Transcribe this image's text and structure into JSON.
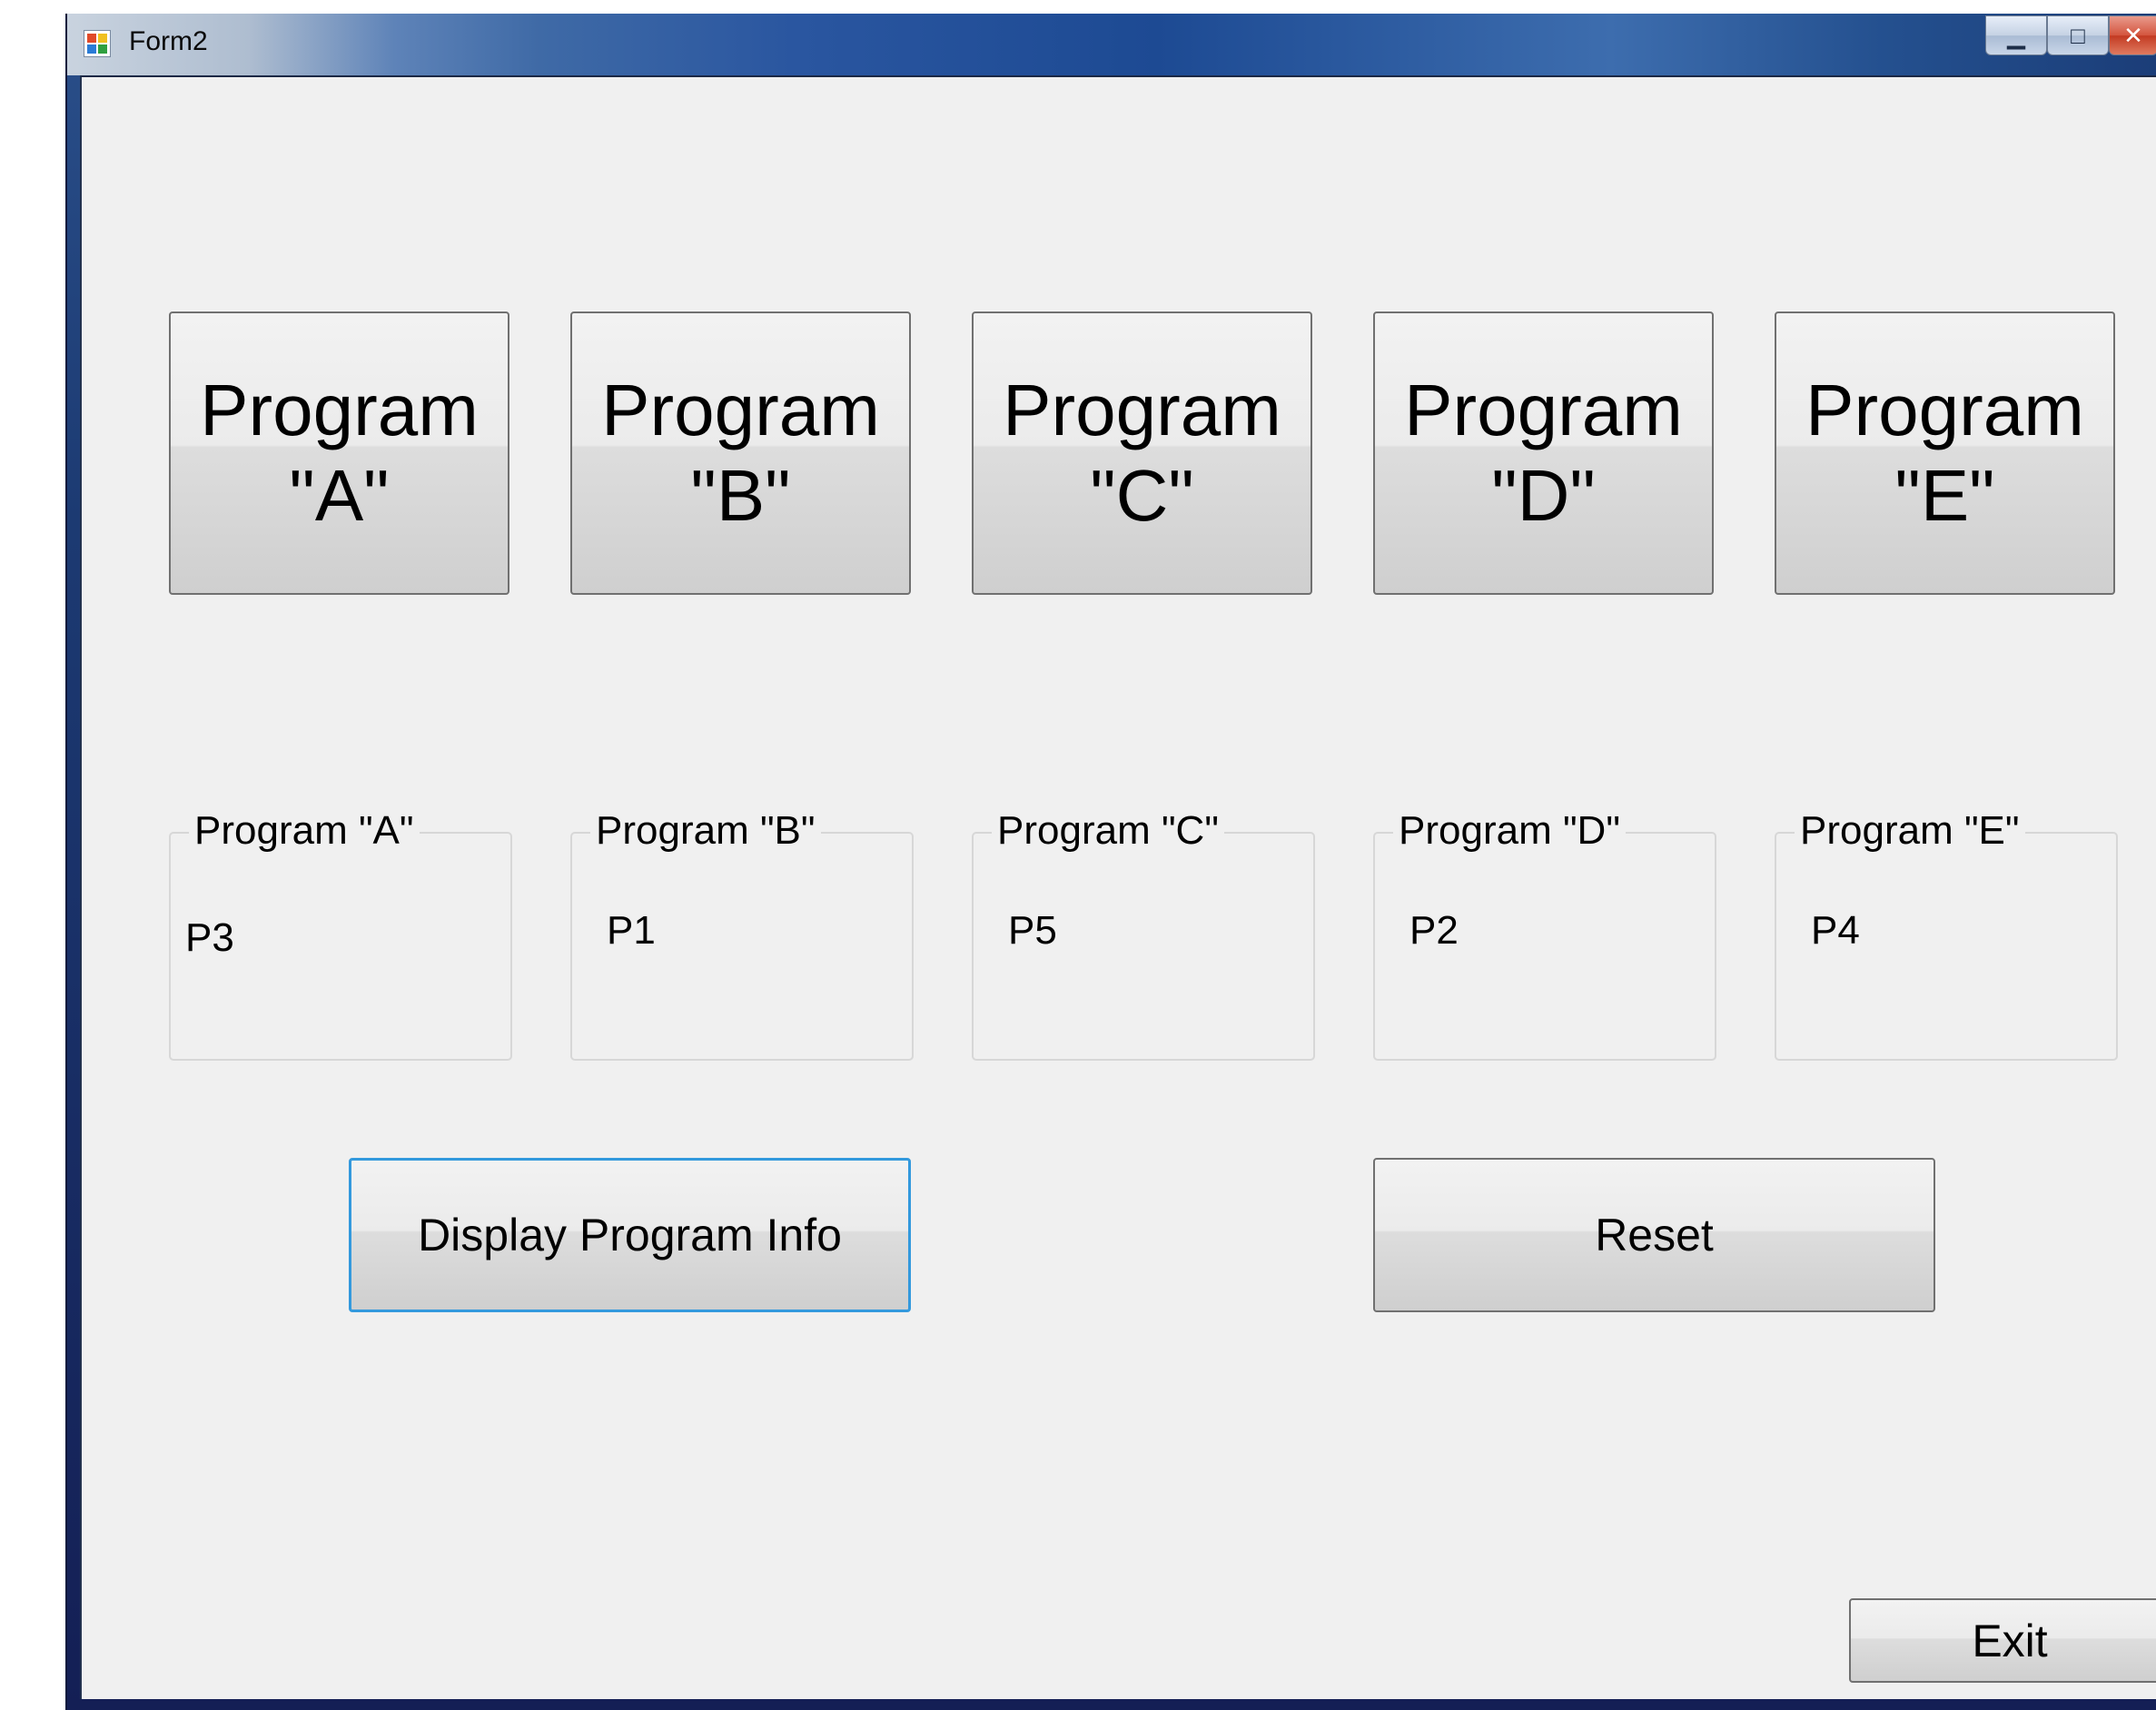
{
  "window": {
    "title": "Form2",
    "controls": {
      "minimize": "▁",
      "maximize": "□",
      "close": "✕"
    }
  },
  "program_buttons": [
    {
      "line1": "Program",
      "line2": "\"A\""
    },
    {
      "line1": "Program",
      "line2": "\"B\""
    },
    {
      "line1": "Program",
      "line2": "\"C\""
    },
    {
      "line1": "Program",
      "line2": "\"D\""
    },
    {
      "line1": "Program",
      "line2": "\"E\""
    }
  ],
  "groups": [
    {
      "label": "Program \"A\"",
      "value": "P3"
    },
    {
      "label": "Program \"B\"",
      "value": "P1"
    },
    {
      "label": "Program \"C\"",
      "value": "P5"
    },
    {
      "label": "Program \"D\"",
      "value": "P2"
    },
    {
      "label": "Program \"E\"",
      "value": "P4"
    }
  ],
  "actions": {
    "display": "Display Program Info",
    "reset": "Reset",
    "exit": "Exit"
  }
}
